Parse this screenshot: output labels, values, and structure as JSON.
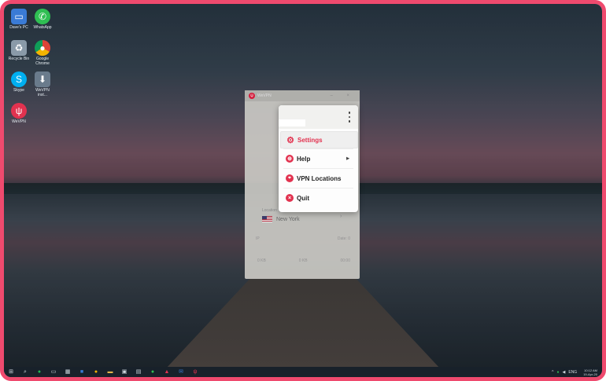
{
  "desktop": {
    "icons": [
      {
        "label": "Dave's PC",
        "icon": "computer-icon"
      },
      {
        "label": "WhatsApp",
        "icon": "whatsapp-icon"
      },
      {
        "label": "Recycle Bin",
        "icon": "recycle-bin-icon"
      },
      {
        "label": "Google Chrome",
        "icon": "chrome-icon"
      },
      {
        "label": "Skype",
        "icon": "skype-icon"
      },
      {
        "label": "WeVPN inst...",
        "icon": "installer-icon"
      },
      {
        "label": "WeVPN",
        "icon": "wevpn-icon"
      }
    ]
  },
  "app": {
    "title": "WeVPN",
    "location_label": "Location",
    "location": "New York",
    "stat_left": "0 KB",
    "stat_mid": "0 KB",
    "stat_right": "00:00",
    "mid_left": "IP",
    "mid_right": "Date: 0"
  },
  "menu": {
    "items": [
      {
        "label": "Settings",
        "icon": "gear-icon"
      },
      {
        "label": "Help",
        "icon": "help-icon"
      },
      {
        "label": "VPN Locations",
        "icon": "location-pin-icon"
      },
      {
        "label": "Quit",
        "icon": "close-circle-icon"
      }
    ]
  },
  "taskbar": {
    "lang": "ENG",
    "time": "10:12 AM",
    "date": "19-Apr-20"
  },
  "colors": {
    "accent": "#e2324f",
    "frame": "#ef4a6e"
  }
}
